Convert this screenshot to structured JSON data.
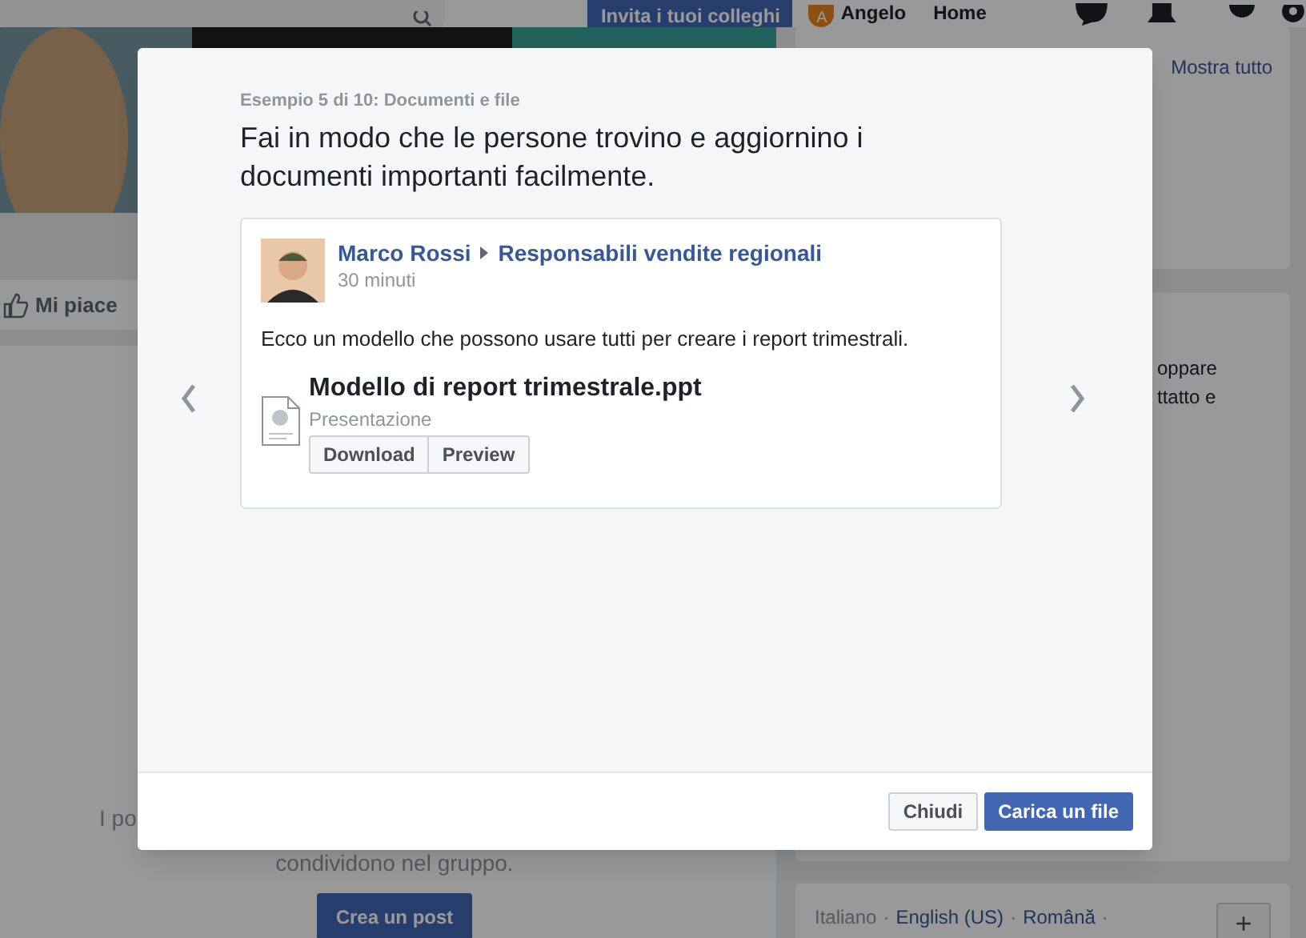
{
  "page": {
    "invite_button": "Invita i tuoi colleghi",
    "user_initial": "A",
    "user_name": "Angelo",
    "home_link": "Home",
    "like_button": "Mi piace",
    "empty_state_line_1": "I po",
    "empty_state_line_2": "condividono nel gruppo.",
    "create_post_button": "Crea un post",
    "show_all_link": "Mostra tutto",
    "side_text_lines": [
      "oppare",
      "ttatto e"
    ],
    "languages": [
      {
        "label": "Italiano",
        "selected": true,
        "separator": "·"
      },
      {
        "label": "English (US)",
        "selected": false,
        "separator": "·"
      },
      {
        "label": "Română",
        "selected": false,
        "separator": "·"
      }
    ],
    "add_language_button": "+"
  },
  "dialog": {
    "step_label": "Esempio 5 di 10: Documenti e file",
    "heading": "Fai in modo che le persone trovino e aggiornino i documenti importanti facilmente.",
    "post": {
      "author": "Marco Rossi",
      "group": "Responsabili vendite regionali",
      "time": "30 minuti",
      "text": "Ecco un modello che possono usare tutti per creare i report trimestrali.",
      "file": {
        "name": "Modello di report trimestrale.ppt",
        "type": "Presentazione",
        "buttons": [
          "Download",
          "Preview"
        ]
      }
    },
    "buttons": [
      {
        "label": "Chiudi",
        "kind": "secondary"
      },
      {
        "label": "Carica un file",
        "kind": "primary"
      }
    ]
  }
}
